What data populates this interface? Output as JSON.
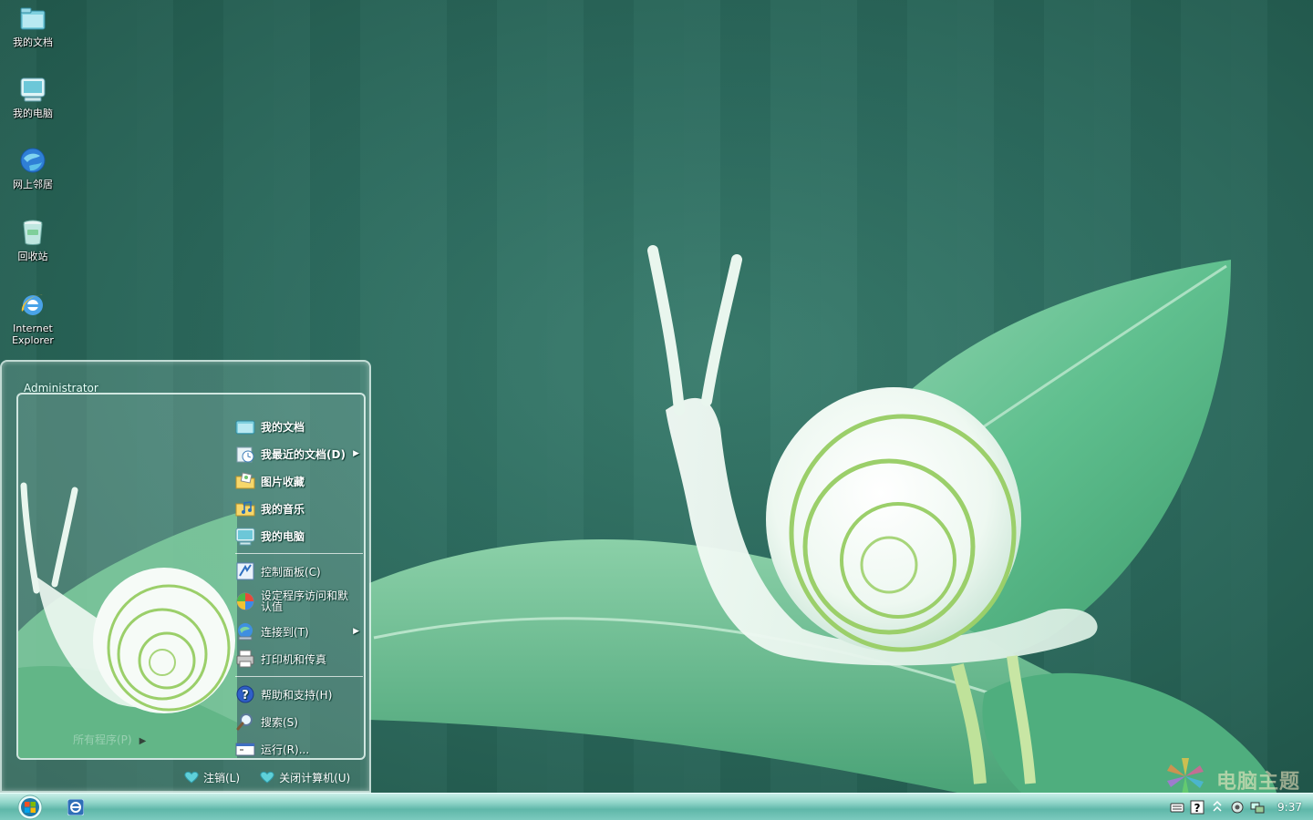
{
  "desktop": {
    "icons": [
      {
        "label": "我的文档",
        "icon": "my-documents-icon"
      },
      {
        "label": "我的电脑",
        "icon": "my-computer-icon"
      },
      {
        "label": "网上邻居",
        "icon": "network-icon"
      },
      {
        "label": "回收站",
        "icon": "recycle-bin-icon"
      },
      {
        "label": "Internet Explorer",
        "icon": "internet-explorer-icon"
      }
    ]
  },
  "start_menu": {
    "user": "Administrator",
    "all_programs": "所有程序(P)",
    "right_items": [
      {
        "label": "我的文档",
        "icon": "my-documents-icon",
        "bold": true
      },
      {
        "label": "我最近的文档(D)",
        "icon": "recent-documents-icon",
        "bold": true,
        "submenu": true
      },
      {
        "label": "图片收藏",
        "icon": "pictures-folder-icon",
        "bold": true
      },
      {
        "label": "我的音乐",
        "icon": "music-folder-icon",
        "bold": true
      },
      {
        "label": "我的电脑",
        "icon": "my-computer-icon",
        "bold": true
      },
      {
        "label": "控制面板(C)",
        "icon": "control-panel-icon"
      },
      {
        "label": "设定程序访问和默认值",
        "icon": "program-access-icon"
      },
      {
        "label": "连接到(T)",
        "icon": "connect-to-icon",
        "submenu": true
      },
      {
        "label": "打印机和传真",
        "icon": "printer-icon"
      },
      {
        "label": "帮助和支持(H)",
        "icon": "help-icon"
      },
      {
        "label": "搜索(S)",
        "icon": "search-icon"
      },
      {
        "label": "运行(R)...",
        "icon": "run-icon"
      }
    ],
    "logoff": "注销(L)",
    "shutdown": "关闭计算机(U)"
  },
  "taskbar": {
    "clock": "9:37"
  },
  "watermark": {
    "text": "电脑主题"
  },
  "colors": {
    "taskbar_top": "#c9eee7",
    "taskbar_bottom": "#5fb7a9",
    "wallpaper": "#2c6b5e"
  }
}
